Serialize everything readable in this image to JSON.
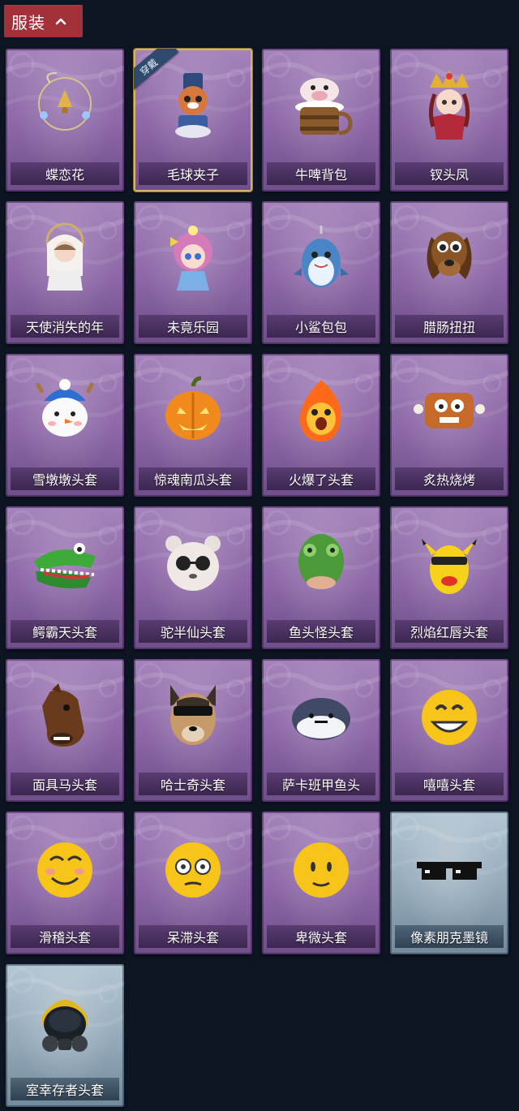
{
  "header": {
    "title": "服装",
    "chevron_icon": "chevron-up-icon",
    "accent": "#a3313a"
  },
  "equipped_badge": "穿戴",
  "items": [
    {
      "label": "蝶恋花",
      "icon": "butterfly-bell-ornament-icon"
    },
    {
      "label": "毛球夹子",
      "icon": "raccoon-drummer-icon",
      "equipped": true
    },
    {
      "label": "牛啤背包",
      "icon": "cow-beer-mug-icon"
    },
    {
      "label": "钗头凤",
      "icon": "phoenix-crown-doll-icon"
    },
    {
      "label": "天使消失的年",
      "icon": "veiled-angel-doll-icon"
    },
    {
      "label": "未竟乐园",
      "icon": "pink-hair-doll-icon"
    },
    {
      "label": "小鲨包包",
      "icon": "shark-bag-icon"
    },
    {
      "label": "腊肠扭扭",
      "icon": "dachshund-head-icon"
    },
    {
      "label": "雪墩墩头套",
      "icon": "snowman-reindeer-head-icon"
    },
    {
      "label": "惊魂南瓜头套",
      "icon": "pumpkin-head-icon"
    },
    {
      "label": "火爆了头套",
      "icon": "fire-spirit-head-icon"
    },
    {
      "label": "炙热烧烤",
      "icon": "bbq-meat-head-icon"
    },
    {
      "label": "鳄霸天头套",
      "icon": "crocodile-head-icon"
    },
    {
      "label": "驼半仙头套",
      "icon": "bear-sunglasses-head-icon"
    },
    {
      "label": "鱼头怪头套",
      "icon": "fish-head-mask-icon"
    },
    {
      "label": "烈焰红唇头套",
      "icon": "yellow-pikachu-mask-icon"
    },
    {
      "label": "面具马头套",
      "icon": "horse-head-mask-icon"
    },
    {
      "label": "哈士奇头套",
      "icon": "husky-sunglasses-head-icon"
    },
    {
      "label": "萨卡班甲鱼头",
      "icon": "sacabambaspis-head-icon"
    },
    {
      "label": "嘻嘻头套",
      "icon": "grinning-emoji-head-icon"
    },
    {
      "label": "滑稽头套",
      "icon": "funny-smile-emoji-head-icon"
    },
    {
      "label": "呆滞头套",
      "icon": "dazed-emoji-head-icon"
    },
    {
      "label": "卑微头套",
      "icon": "timid-emoji-head-icon"
    },
    {
      "label": "像素朋克墨镜",
      "icon": "pixel-sunglasses-icon",
      "alt": true
    },
    {
      "label": "室幸存者头套",
      "icon": "gas-mask-helmet-icon",
      "alt": true
    }
  ]
}
